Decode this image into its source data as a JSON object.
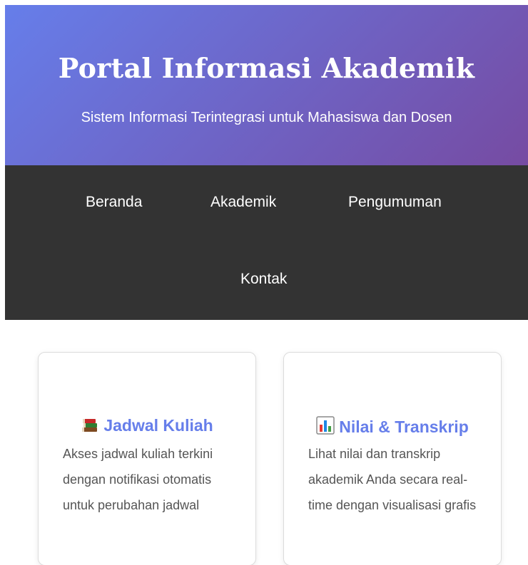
{
  "header": {
    "title": "Portal Informasi Akademik",
    "subtitle": "Sistem Informasi Terintegrasi untuk Mahasiswa dan Dosen"
  },
  "nav": {
    "items": [
      {
        "label": "Beranda"
      },
      {
        "label": "Akademik"
      },
      {
        "label": "Pengumuman"
      },
      {
        "label": "Kontak"
      }
    ]
  },
  "cards": [
    {
      "icon": "books-icon",
      "title": "Jadwal Kuliah",
      "body": "Akses jadwal kuliah terkini dengan notifikasi otomatis untuk perubahan jadwal"
    },
    {
      "icon": "bar-chart-icon",
      "title": "Nilai & Transkrip",
      "body": "Lihat nilai dan transkrip akademik Anda secara real-time dengan visualisasi grafis"
    }
  ],
  "colors": {
    "gradient_start": "#667eea",
    "gradient_end": "#764ba2",
    "nav_background": "#333333",
    "card_title": "#667eea",
    "body_text": "#555555"
  }
}
